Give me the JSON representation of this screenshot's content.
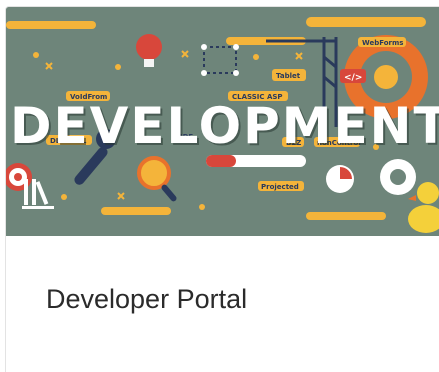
{
  "card": {
    "title": "Developer Portal",
    "banner_word": "DEVELOPMENT",
    "banner_icon": "library-icon",
    "banner_labels": [
      "Tablet",
      "VoIdFrom",
      "CLASSIC ASP",
      "IDE",
      "DLL DLLL",
      "B2Z",
      "nonControl",
      "Projected",
      "WebForms",
      "</>"
    ]
  },
  "colors": {
    "banner_bg": "#6e857a",
    "accent_yellow": "#f4b43a",
    "accent_orange": "#e8722c",
    "accent_red": "#d8473b",
    "accent_navy": "#2a3a5c",
    "title_text": "#2b2b2b"
  }
}
